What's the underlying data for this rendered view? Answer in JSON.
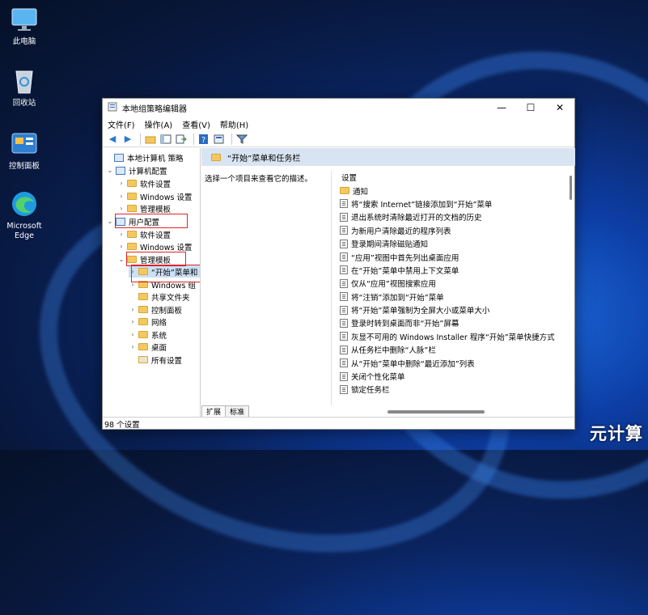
{
  "desktop": {
    "icons": [
      {
        "label": "此电脑"
      },
      {
        "label": "回收站"
      },
      {
        "label": "控制面板"
      },
      {
        "label": "Microsoft Edge"
      }
    ],
    "watermark": "元计算"
  },
  "window": {
    "title": "本地组策略编辑器",
    "controls": {
      "min": "—",
      "max": "☐",
      "close": "✕"
    }
  },
  "menu": [
    "文件(F)",
    "操作(A)",
    "查看(V)",
    "帮助(H)"
  ],
  "tree": [
    {
      "label": "本地计算机 策略"
    },
    {
      "label": "计算机配置"
    },
    {
      "label": "软件设置"
    },
    {
      "label": "Windows 设置"
    },
    {
      "label": "管理模板"
    },
    {
      "label": "用户配置"
    },
    {
      "label": "软件设置"
    },
    {
      "label": "Windows 设置"
    },
    {
      "label": "管理模板"
    },
    {
      "label": "“开始”菜单和"
    },
    {
      "label": "Windows 组"
    },
    {
      "label": "共享文件夹"
    },
    {
      "label": "控制面板"
    },
    {
      "label": "网络"
    },
    {
      "label": "系统"
    },
    {
      "label": "桌面"
    },
    {
      "label": "所有设置"
    }
  ],
  "main": {
    "header": "“开始”菜单和任务栏",
    "description": "选择一个项目来查看它的描述。",
    "col_header": "设置",
    "items": [
      "通知",
      "将“搜索 Internet”链接添加到“开始”菜单",
      "退出系统时清除最近打开的文档的历史",
      "为新用户清除最近的程序列表",
      "登录期间清除磁贴通知",
      "“应用”视图中首先列出桌面应用",
      "在“开始”菜单中禁用上下文菜单",
      "仅从“应用”视图搜索应用",
      "将“注销”添加到“开始”菜单",
      "将“开始”菜单强制为全屏大小或菜单大小",
      "登录时转到桌面而非“开始”屏幕",
      "灰显不可用的 Windows Installer 程序“开始”菜单快捷方式",
      "从任务栏中删除“人脉”栏",
      "从“开始”菜单中删除“最近添加”列表",
      "关闭个性化菜单",
      "锁定任务栏"
    ]
  },
  "tabs": [
    "扩展",
    "标准"
  ],
  "status": "98 个设置"
}
